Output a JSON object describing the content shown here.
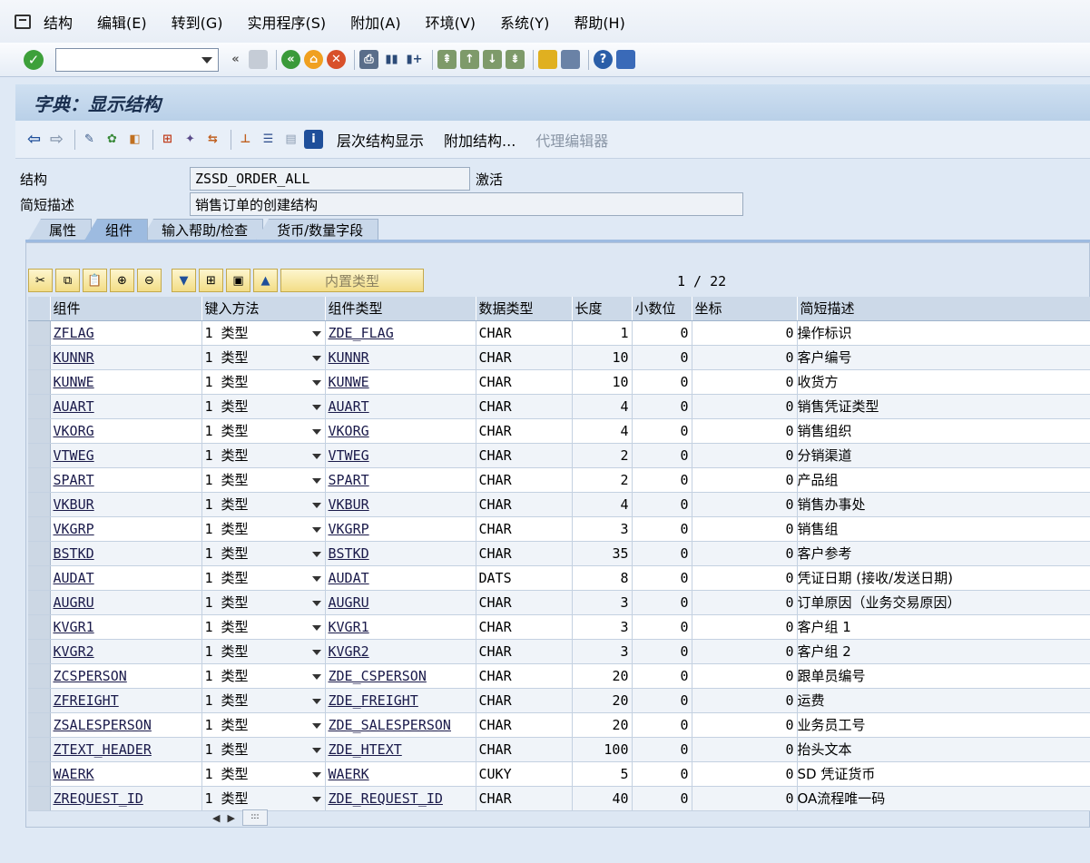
{
  "menu": [
    "结构",
    "编辑(E)",
    "转到(G)",
    "实用程序(S)",
    "附加(A)",
    "环境(V)",
    "系统(Y)",
    "帮助(H)"
  ],
  "title": "字典：显示结构",
  "app_toolbar": {
    "hierarchy": "层次结构显示",
    "append": "附加结构...",
    "proxy": "代理编辑器"
  },
  "header": {
    "structure_label": "结构",
    "structure_value": "ZSSD_ORDER_ALL",
    "status": "激活",
    "desc_label": "简短描述",
    "desc_value": "销售订单的创建结构"
  },
  "tabs": [
    "属性",
    "组件",
    "输入帮助/检查",
    "货币/数量字段"
  ],
  "grid": {
    "builtin_type_btn": "内置类型",
    "pager": "1 / 22",
    "columns": [
      "组件",
      "键入方法",
      "组件类型",
      "数据类型",
      "长度",
      "小数位",
      "坐标",
      "简短描述"
    ],
    "rows": [
      {
        "comp": "ZFLAG",
        "method": "1 类型",
        "type": "ZDE_FLAG",
        "dtype": "CHAR",
        "len": "1",
        "dec": "0",
        "coord": "0",
        "desc": "操作标识"
      },
      {
        "comp": "KUNNR",
        "method": "1 类型",
        "type": "KUNNR",
        "dtype": "CHAR",
        "len": "10",
        "dec": "0",
        "coord": "0",
        "desc": "客户编号"
      },
      {
        "comp": "KUNWE",
        "method": "1 类型",
        "type": "KUNWE",
        "dtype": "CHAR",
        "len": "10",
        "dec": "0",
        "coord": "0",
        "desc": "收货方"
      },
      {
        "comp": "AUART",
        "method": "1 类型",
        "type": "AUART",
        "dtype": "CHAR",
        "len": "4",
        "dec": "0",
        "coord": "0",
        "desc": "销售凭证类型"
      },
      {
        "comp": "VKORG",
        "method": "1 类型",
        "type": "VKORG",
        "dtype": "CHAR",
        "len": "4",
        "dec": "0",
        "coord": "0",
        "desc": "销售组织"
      },
      {
        "comp": "VTWEG",
        "method": "1 类型",
        "type": "VTWEG",
        "dtype": "CHAR",
        "len": "2",
        "dec": "0",
        "coord": "0",
        "desc": "分销渠道"
      },
      {
        "comp": "SPART",
        "method": "1 类型",
        "type": "SPART",
        "dtype": "CHAR",
        "len": "2",
        "dec": "0",
        "coord": "0",
        "desc": "产品组"
      },
      {
        "comp": "VKBUR",
        "method": "1 类型",
        "type": "VKBUR",
        "dtype": "CHAR",
        "len": "4",
        "dec": "0",
        "coord": "0",
        "desc": "销售办事处"
      },
      {
        "comp": "VKGRP",
        "method": "1 类型",
        "type": "VKGRP",
        "dtype": "CHAR",
        "len": "3",
        "dec": "0",
        "coord": "0",
        "desc": "销售组"
      },
      {
        "comp": "BSTKD",
        "method": "1 类型",
        "type": "BSTKD",
        "dtype": "CHAR",
        "len": "35",
        "dec": "0",
        "coord": "0",
        "desc": "客户参考"
      },
      {
        "comp": "AUDAT",
        "method": "1 类型",
        "type": "AUDAT",
        "dtype": "DATS",
        "len": "8",
        "dec": "0",
        "coord": "0",
        "desc": "凭证日期 (接收/发送日期)"
      },
      {
        "comp": "AUGRU",
        "method": "1 类型",
        "type": "AUGRU",
        "dtype": "CHAR",
        "len": "3",
        "dec": "0",
        "coord": "0",
        "desc": "订单原因（业务交易原因）"
      },
      {
        "comp": "KVGR1",
        "method": "1 类型",
        "type": "KVGR1",
        "dtype": "CHAR",
        "len": "3",
        "dec": "0",
        "coord": "0",
        "desc": "客户组 1"
      },
      {
        "comp": "KVGR2",
        "method": "1 类型",
        "type": "KVGR2",
        "dtype": "CHAR",
        "len": "3",
        "dec": "0",
        "coord": "0",
        "desc": "客户组 2"
      },
      {
        "comp": "ZCSPERSON",
        "method": "1 类型",
        "type": "ZDE_CSPERSON",
        "dtype": "CHAR",
        "len": "20",
        "dec": "0",
        "coord": "0",
        "desc": "跟单员编号"
      },
      {
        "comp": "ZFREIGHT",
        "method": "1 类型",
        "type": "ZDE_FREIGHT",
        "dtype": "CHAR",
        "len": "20",
        "dec": "0",
        "coord": "0",
        "desc": "运费"
      },
      {
        "comp": "ZSALESPERSON",
        "method": "1 类型",
        "type": "ZDE_SALESPERSON",
        "dtype": "CHAR",
        "len": "20",
        "dec": "0",
        "coord": "0",
        "desc": "业务员工号"
      },
      {
        "comp": "ZTEXT_HEADER",
        "method": "1 类型",
        "type": "ZDE_HTEXT",
        "dtype": "CHAR",
        "len": "100",
        "dec": "0",
        "coord": "0",
        "desc": "抬头文本"
      },
      {
        "comp": "WAERK",
        "method": "1 类型",
        "type": "WAERK",
        "dtype": "CUKY",
        "len": "5",
        "dec": "0",
        "coord": "0",
        "desc": "SD 凭证货币"
      },
      {
        "comp": "ZREQUEST_ID",
        "method": "1 类型",
        "type": "ZDE_REQUEST_ID",
        "dtype": "CHAR",
        "len": "40",
        "dec": "0",
        "coord": "0",
        "desc": "OA流程唯一码"
      }
    ]
  }
}
